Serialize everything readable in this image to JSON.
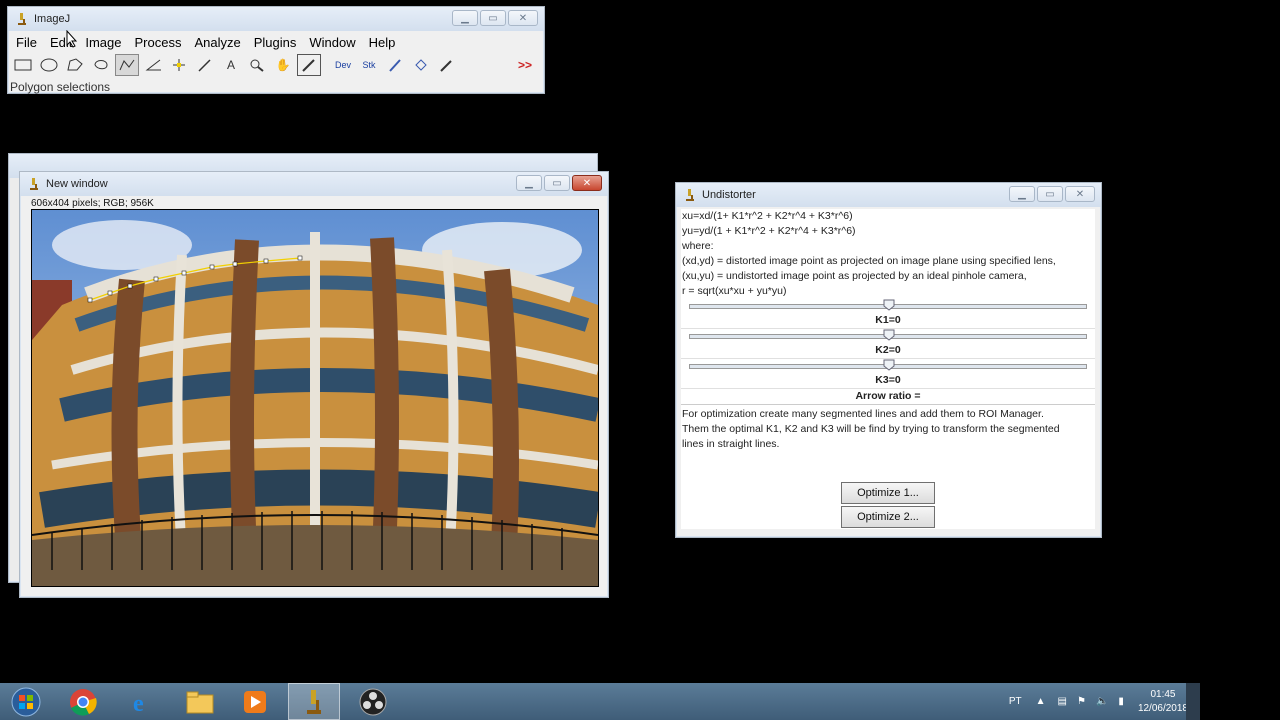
{
  "imagej": {
    "title": "ImageJ",
    "menu": [
      "File",
      "Edit",
      "Image",
      "Process",
      "Analyze",
      "Plugins",
      "Window",
      "Help"
    ],
    "tools": {
      "dev": "Dev",
      "stk": "Stk",
      "more": ">>"
    },
    "status": "Polygon selections"
  },
  "new_window": {
    "title": "New window",
    "info": "606x404 pixels; RGB; 956K"
  },
  "undistorter": {
    "title": "Undistorter",
    "lines": [
      "xu=xd/(1+ K1*r^2 + K2*r^4 + K3*r^6)",
      "yu=yd/(1 + K1*r^2 + K2*r^4 + K3*r^6)",
      "where:",
      "(xd,yd) = distorted image point as projected on image plane using specified lens,",
      "(xu,yu) = undistorted image point as projected by an ideal pinhole camera,",
      "r = sqrt(xu*xu + yu*yu)"
    ],
    "k1": "K1=0",
    "k2": "K2=0",
    "k3": "K3=0",
    "arrow_ratio": "Arrow ratio =",
    "hint": [
      "For optimization create many segmented lines and add them to ROI Manager.",
      "Them the optimal K1, K2 and K3 will be find by trying to transform the segmented",
      "lines in straight lines."
    ],
    "optimize1": "Optimize 1...",
    "optimize2": "Optimize 2..."
  },
  "taskbar": {
    "lang": "PT",
    "time": "01:45",
    "date": "12/06/2018"
  }
}
